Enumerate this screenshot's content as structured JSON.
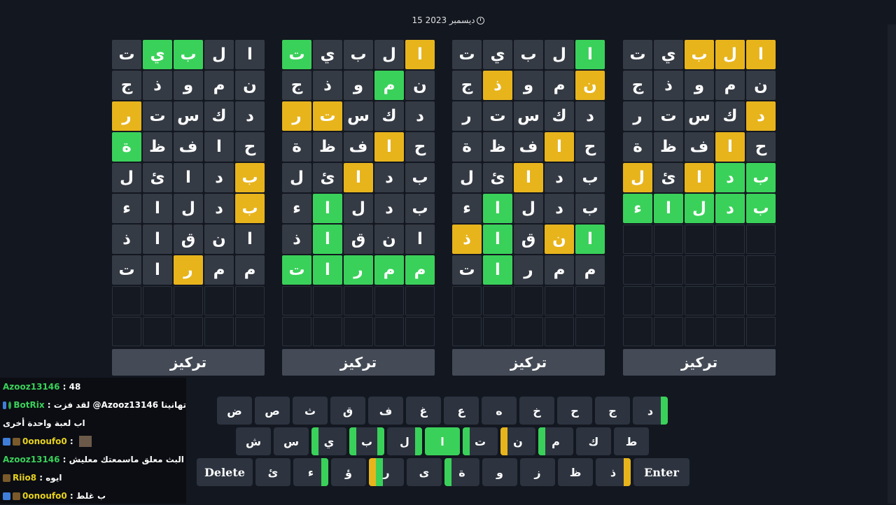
{
  "date": "15 ديسمبر 2023",
  "focus_label": "تركيز",
  "boards": [
    {
      "rows": [
        [
          [
            "ت",
            "n"
          ],
          [
            "ي",
            "g"
          ],
          [
            "ب",
            "g"
          ],
          [
            "ل",
            "n"
          ],
          [
            "ا",
            "n"
          ]
        ],
        [
          [
            "ج",
            "n"
          ],
          [
            "ذ",
            "n"
          ],
          [
            "و",
            "n"
          ],
          [
            "م",
            "n"
          ],
          [
            "ن",
            "n"
          ]
        ],
        [
          [
            "ر",
            "y"
          ],
          [
            "ت",
            "n"
          ],
          [
            "س",
            "n"
          ],
          [
            "ك",
            "n"
          ],
          [
            "د",
            "n"
          ]
        ],
        [
          [
            "ة",
            "g"
          ],
          [
            "ظ",
            "n"
          ],
          [
            "ف",
            "n"
          ],
          [
            "ا",
            "n"
          ],
          [
            "ح",
            "n"
          ]
        ],
        [
          [
            "ل",
            "n"
          ],
          [
            "ئ",
            "n"
          ],
          [
            "ا",
            "n"
          ],
          [
            "د",
            "n"
          ],
          [
            "ب",
            "y"
          ]
        ],
        [
          [
            "ء",
            "n"
          ],
          [
            "ا",
            "n"
          ],
          [
            "ل",
            "n"
          ],
          [
            "د",
            "n"
          ],
          [
            "ب",
            "y"
          ]
        ],
        [
          [
            "ذ",
            "n"
          ],
          [
            "ا",
            "n"
          ],
          [
            "ق",
            "n"
          ],
          [
            "ن",
            "n"
          ],
          [
            "ا",
            "n"
          ]
        ],
        [
          [
            "ت",
            "n"
          ],
          [
            "ا",
            "n"
          ],
          [
            "ر",
            "y"
          ],
          [
            "م",
            "n"
          ],
          [
            "م",
            "n"
          ]
        ],
        [
          [
            "",
            "e"
          ],
          [
            "",
            "e"
          ],
          [
            "",
            "e"
          ],
          [
            "",
            "e"
          ],
          [
            "",
            "e"
          ]
        ],
        [
          [
            "",
            "e"
          ],
          [
            "",
            "e"
          ],
          [
            "",
            "e"
          ],
          [
            "",
            "e"
          ],
          [
            "",
            "e"
          ]
        ]
      ]
    },
    {
      "rows": [
        [
          [
            "ت",
            "g"
          ],
          [
            "ي",
            "n"
          ],
          [
            "ب",
            "n"
          ],
          [
            "ل",
            "n"
          ],
          [
            "ا",
            "y"
          ]
        ],
        [
          [
            "ج",
            "n"
          ],
          [
            "ذ",
            "n"
          ],
          [
            "و",
            "n"
          ],
          [
            "م",
            "g"
          ],
          [
            "ن",
            "n"
          ]
        ],
        [
          [
            "ر",
            "y"
          ],
          [
            "ت",
            "y"
          ],
          [
            "س",
            "n"
          ],
          [
            "ك",
            "n"
          ],
          [
            "د",
            "n"
          ]
        ],
        [
          [
            "ة",
            "n"
          ],
          [
            "ظ",
            "n"
          ],
          [
            "ف",
            "n"
          ],
          [
            "ا",
            "y"
          ],
          [
            "ح",
            "n"
          ]
        ],
        [
          [
            "ل",
            "n"
          ],
          [
            "ئ",
            "n"
          ],
          [
            "ا",
            "y"
          ],
          [
            "د",
            "n"
          ],
          [
            "ب",
            "n"
          ]
        ],
        [
          [
            "ء",
            "n"
          ],
          [
            "ا",
            "g"
          ],
          [
            "ل",
            "n"
          ],
          [
            "د",
            "n"
          ],
          [
            "ب",
            "n"
          ]
        ],
        [
          [
            "ذ",
            "n"
          ],
          [
            "ا",
            "g"
          ],
          [
            "ق",
            "n"
          ],
          [
            "ن",
            "n"
          ],
          [
            "ا",
            "n"
          ]
        ],
        [
          [
            "ت",
            "g"
          ],
          [
            "ا",
            "g"
          ],
          [
            "ر",
            "g"
          ],
          [
            "م",
            "g"
          ],
          [
            "م",
            "g"
          ]
        ],
        [
          [
            "",
            "e"
          ],
          [
            "",
            "e"
          ],
          [
            "",
            "e"
          ],
          [
            "",
            "e"
          ],
          [
            "",
            "e"
          ]
        ],
        [
          [
            "",
            "e"
          ],
          [
            "",
            "e"
          ],
          [
            "",
            "e"
          ],
          [
            "",
            "e"
          ],
          [
            "",
            "e"
          ]
        ]
      ]
    },
    {
      "rows": [
        [
          [
            "ت",
            "n"
          ],
          [
            "ي",
            "n"
          ],
          [
            "ب",
            "n"
          ],
          [
            "ل",
            "n"
          ],
          [
            "ا",
            "g"
          ]
        ],
        [
          [
            "ج",
            "n"
          ],
          [
            "ذ",
            "y"
          ],
          [
            "و",
            "n"
          ],
          [
            "م",
            "n"
          ],
          [
            "ن",
            "y"
          ]
        ],
        [
          [
            "ر",
            "n"
          ],
          [
            "ت",
            "n"
          ],
          [
            "س",
            "n"
          ],
          [
            "ك",
            "n"
          ],
          [
            "د",
            "n"
          ]
        ],
        [
          [
            "ة",
            "n"
          ],
          [
            "ظ",
            "n"
          ],
          [
            "ف",
            "n"
          ],
          [
            "ا",
            "y"
          ],
          [
            "ح",
            "n"
          ]
        ],
        [
          [
            "ل",
            "n"
          ],
          [
            "ئ",
            "n"
          ],
          [
            "ا",
            "y"
          ],
          [
            "د",
            "n"
          ],
          [
            "ب",
            "n"
          ]
        ],
        [
          [
            "ء",
            "n"
          ],
          [
            "ا",
            "g"
          ],
          [
            "ل",
            "n"
          ],
          [
            "د",
            "n"
          ],
          [
            "ب",
            "n"
          ]
        ],
        [
          [
            "ذ",
            "y"
          ],
          [
            "ا",
            "g"
          ],
          [
            "ق",
            "n"
          ],
          [
            "ن",
            "y"
          ],
          [
            "ا",
            "g"
          ]
        ],
        [
          [
            "ت",
            "n"
          ],
          [
            "ا",
            "g"
          ],
          [
            "ر",
            "n"
          ],
          [
            "م",
            "n"
          ],
          [
            "م",
            "n"
          ]
        ],
        [
          [
            "",
            "e"
          ],
          [
            "",
            "e"
          ],
          [
            "",
            "e"
          ],
          [
            "",
            "e"
          ],
          [
            "",
            "e"
          ]
        ],
        [
          [
            "",
            "e"
          ],
          [
            "",
            "e"
          ],
          [
            "",
            "e"
          ],
          [
            "",
            "e"
          ],
          [
            "",
            "e"
          ]
        ]
      ]
    },
    {
      "rows": [
        [
          [
            "ت",
            "n"
          ],
          [
            "ي",
            "n"
          ],
          [
            "ب",
            "y"
          ],
          [
            "ل",
            "y"
          ],
          [
            "ا",
            "y"
          ]
        ],
        [
          [
            "ج",
            "n"
          ],
          [
            "ذ",
            "n"
          ],
          [
            "و",
            "n"
          ],
          [
            "م",
            "n"
          ],
          [
            "ن",
            "n"
          ]
        ],
        [
          [
            "ر",
            "n"
          ],
          [
            "ت",
            "n"
          ],
          [
            "س",
            "n"
          ],
          [
            "ك",
            "n"
          ],
          [
            "د",
            "y"
          ]
        ],
        [
          [
            "ة",
            "n"
          ],
          [
            "ظ",
            "n"
          ],
          [
            "ف",
            "n"
          ],
          [
            "ا",
            "y"
          ],
          [
            "ح",
            "n"
          ]
        ],
        [
          [
            "ل",
            "y"
          ],
          [
            "ئ",
            "n"
          ],
          [
            "ا",
            "y"
          ],
          [
            "د",
            "g"
          ],
          [
            "ب",
            "g"
          ]
        ],
        [
          [
            "ء",
            "g"
          ],
          [
            "ا",
            "g"
          ],
          [
            "ل",
            "g"
          ],
          [
            "د",
            "g"
          ],
          [
            "ب",
            "g"
          ]
        ],
        [
          [
            "",
            "e"
          ],
          [
            "",
            "e"
          ],
          [
            "",
            "e"
          ],
          [
            "",
            "e"
          ],
          [
            "",
            "e"
          ]
        ],
        [
          [
            "",
            "e"
          ],
          [
            "",
            "e"
          ],
          [
            "",
            "e"
          ],
          [
            "",
            "e"
          ],
          [
            "",
            "e"
          ]
        ],
        [
          [
            "",
            "e"
          ],
          [
            "",
            "e"
          ],
          [
            "",
            "e"
          ],
          [
            "",
            "e"
          ],
          [
            "",
            "e"
          ]
        ],
        [
          [
            "",
            "e"
          ],
          [
            "",
            "e"
          ],
          [
            "",
            "e"
          ],
          [
            "",
            "e"
          ],
          [
            "",
            "e"
          ]
        ]
      ]
    }
  ],
  "keyboard": {
    "row1": [
      {
        "label": "ض",
        "bars": []
      },
      {
        "label": "ص",
        "bars": []
      },
      {
        "label": "ث",
        "bars": []
      },
      {
        "label": "ق",
        "bars": []
      },
      {
        "label": "ف",
        "bars": []
      },
      {
        "label": "غ",
        "bars": []
      },
      {
        "label": "ع",
        "bars": []
      },
      {
        "label": "ه",
        "bars": []
      },
      {
        "label": "خ",
        "bars": []
      },
      {
        "label": "ح",
        "bars": []
      },
      {
        "label": "ج",
        "bars": []
      },
      {
        "label": "د",
        "bars": [
          "rg"
        ]
      }
    ],
    "row2": [
      {
        "label": "ش",
        "bars": []
      },
      {
        "label": "س",
        "bars": []
      },
      {
        "label": "ي",
        "bars": [
          "lg"
        ]
      },
      {
        "label": "ب",
        "bars": [
          "lg",
          "rg"
        ]
      },
      {
        "label": "ل",
        "bars": [
          "rg"
        ]
      },
      {
        "label": "ا",
        "bars": [],
        "full": "g"
      },
      {
        "label": "ت",
        "bars": [
          "lg"
        ]
      },
      {
        "label": "ن",
        "bars": [
          "ly"
        ]
      },
      {
        "label": "م",
        "bars": [
          "lg"
        ]
      },
      {
        "label": "ك",
        "bars": []
      },
      {
        "label": "ط",
        "bars": []
      }
    ],
    "row3": [
      {
        "label": "Delete",
        "wide": true,
        "bars": []
      },
      {
        "label": "ئ",
        "bars": []
      },
      {
        "label": "ء",
        "bars": [
          "rg"
        ]
      },
      {
        "label": "ؤ",
        "bars": []
      },
      {
        "label": "ر",
        "bars": [
          "ly",
          "l2g"
        ]
      },
      {
        "label": "ى",
        "bars": []
      },
      {
        "label": "ة",
        "bars": [
          "lg"
        ]
      },
      {
        "label": "و",
        "bars": []
      },
      {
        "label": "ز",
        "bars": []
      },
      {
        "label": "ظ",
        "bars": []
      },
      {
        "label": "ذ",
        "bars": [
          "ry"
        ]
      },
      {
        "label": "Enter",
        "wide": true,
        "bars": []
      }
    ]
  },
  "chat": [
    {
      "user": "Azooz13146",
      "text": "48",
      "color": "#3ad15a",
      "badges": []
    },
    {
      "user": "BotRix",
      "text": "لقد فزت @Azooz13146 تهانينا",
      "color": "#3ad15a",
      "badges": [
        "b",
        "gr"
      ]
    },
    {
      "user": "",
      "text": "اب لعبة واحدة أخرى",
      "color": "#fff",
      "badges": []
    },
    {
      "user": "0onoufo0",
      "text": "",
      "color": "#e7d21c",
      "badges": [
        "b",
        "br"
      ],
      "avatar": true
    },
    {
      "user": "Azooz13146",
      "text": "البث معلق ماسمعتك معليش",
      "color": "#3ad15a",
      "badges": []
    },
    {
      "user": "Riio8",
      "text": "ايوه",
      "color": "#e7d21c",
      "badges": [
        "br"
      ]
    },
    {
      "user": "0onoufo0",
      "text": "ب غلط",
      "color": "#e7d21c",
      "badges": [
        "b",
        "br"
      ]
    }
  ]
}
